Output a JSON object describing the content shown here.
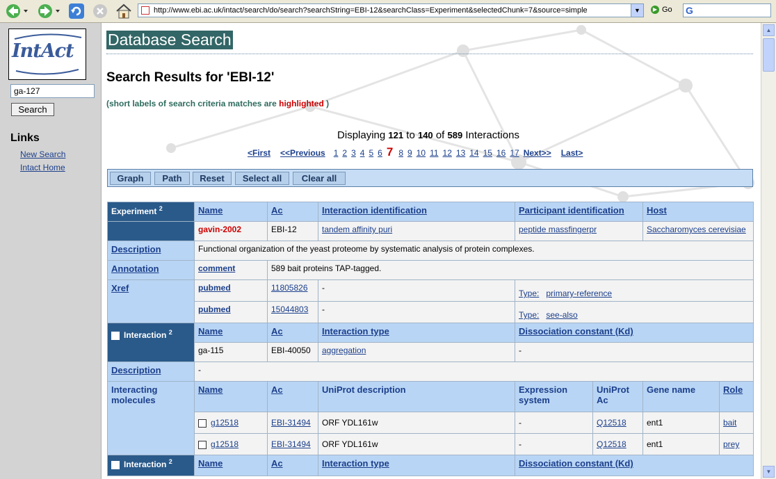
{
  "browser": {
    "url": "http://www.ebi.ac.uk/intact/search/do/search?searchString=EBI-12&searchClass=Experiment&selectedChunk=7&source=simple",
    "go_label": "Go"
  },
  "sidebar": {
    "logo_text": "IntAct",
    "search_value": "ga-127",
    "search_button": "Search",
    "links_heading": "Links",
    "links": [
      "New Search",
      "Intact Home"
    ]
  },
  "main": {
    "page_title": "Database Search",
    "results_heading": "Search Results for 'EBI-12'",
    "note_prefix": "(short labels of search criteria matches are",
    "note_highlight": "highlighted",
    "note_suffix": ")",
    "displaying": {
      "prefix": "Displaying",
      "from": "121",
      "to_word": "to",
      "to": "140",
      "of_word": "of",
      "total": "589",
      "suffix": "Interactions"
    },
    "pager": {
      "first": "<First",
      "previous": "<<Previous",
      "pages_before": [
        "1",
        "2",
        "3",
        "4",
        "5",
        "6"
      ],
      "current": "7",
      "pages_after": [
        "8",
        "9",
        "10",
        "11",
        "12",
        "13",
        "14",
        "15",
        "16",
        "17"
      ],
      "next": "Next>>",
      "last": "Last>"
    },
    "actions": [
      "Graph",
      "Path",
      "Reset",
      "Select all",
      "Clear all"
    ]
  },
  "experiment": {
    "header": "Experiment",
    "sup": "2",
    "columns": [
      "Name",
      "Ac",
      "Interaction identification",
      "Participant identification",
      "Host"
    ],
    "row": [
      "gavin-2002",
      "EBI-12",
      "tandem affinity puri",
      "peptide massfingerpr",
      "Saccharomyces cerevisiae"
    ],
    "description_label": "Description",
    "description": "Functional organization of the yeast proteome by systematic analysis of protein complexes.",
    "annotation_label": "Annotation",
    "annotation_topic": "comment",
    "annotation_text": "589 bait proteins TAP-tagged.",
    "xref_label": "Xref",
    "xrefs": [
      {
        "db": "pubmed",
        "id": "11805826",
        "desc": "-",
        "type_label": "Type:",
        "type": "primary-reference"
      },
      {
        "db": "pubmed",
        "id": "15044803",
        "desc": "-",
        "type_label": "Type:",
        "type": "see-also"
      }
    ]
  },
  "interaction": {
    "header": "Interaction",
    "sup": "2",
    "columns": [
      "Name",
      "Ac",
      "Interaction type",
      "Dissociation constant (Kd)"
    ],
    "row": [
      "ga-115",
      "EBI-40050",
      "aggregation",
      "-"
    ],
    "description_label": "Description",
    "description": "-",
    "molecules_label": "Interacting molecules",
    "mol_columns": [
      "Name",
      "Ac",
      "UniProt description",
      "Expression system",
      "UniProt Ac",
      "Gene name",
      "Role"
    ],
    "molecules": [
      [
        "g12518",
        "EBI-31494",
        "ORF YDL161w",
        "-",
        "Q12518",
        "ent1",
        "bait"
      ],
      [
        "g12518",
        "EBI-31494",
        "ORF YDL161w",
        "-",
        "Q12518",
        "ent1",
        "prey"
      ]
    ]
  },
  "interaction2": {
    "header": "Interaction",
    "sup": "2",
    "columns": [
      "Name",
      "Ac",
      "Interaction type",
      "Dissociation constant (Kd)"
    ]
  }
}
